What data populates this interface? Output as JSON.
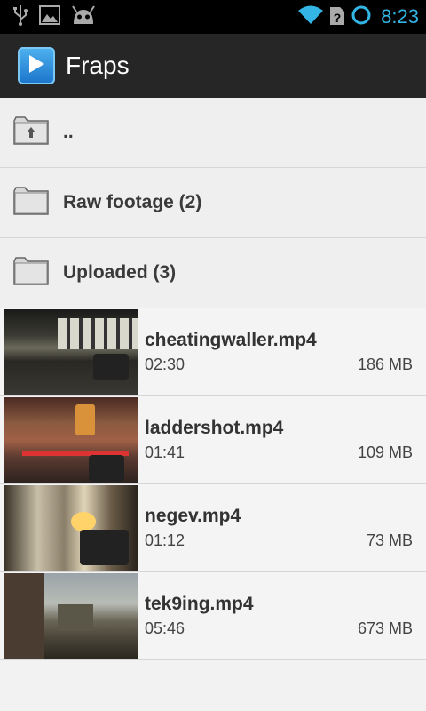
{
  "status_bar": {
    "time": "8:23",
    "icons": [
      "usb-icon",
      "image-icon",
      "android-debug-icon",
      "wifi-icon",
      "sim-unknown-icon",
      "sync-circle-icon"
    ],
    "accent": "#33b5e5"
  },
  "app": {
    "title": "Fraps",
    "icon": "play-icon"
  },
  "folders": [
    {
      "label": "..",
      "icon": "folder-up-icon"
    },
    {
      "label": "Raw footage (2)",
      "icon": "folder-icon"
    },
    {
      "label": "Uploaded (3)",
      "icon": "folder-icon"
    }
  ],
  "videos": [
    {
      "name": "cheatingwaller.mp4",
      "duration": "02:30",
      "size": "186 MB"
    },
    {
      "name": "laddershot.mp4",
      "duration": "01:41",
      "size": "109 MB"
    },
    {
      "name": "negev.mp4",
      "duration": "01:12",
      "size": "73 MB"
    },
    {
      "name": "tek9ing.mp4",
      "duration": "05:46",
      "size": "673 MB"
    }
  ]
}
